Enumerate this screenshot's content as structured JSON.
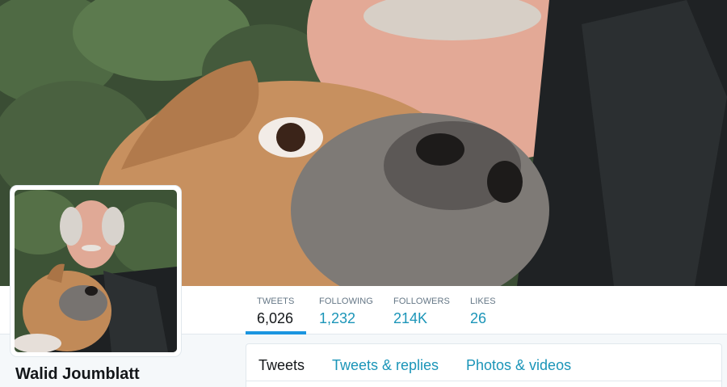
{
  "profile": {
    "name": "Walid Joumblatt"
  },
  "stats": [
    {
      "label": "TWEETS",
      "value": "6,026"
    },
    {
      "label": "FOLLOWING",
      "value": "1,232"
    },
    {
      "label": "FOLLOWERS",
      "value": "214K"
    },
    {
      "label": "LIKES",
      "value": "26"
    }
  ],
  "tabs": [
    {
      "label": "Tweets"
    },
    {
      "label": "Tweets & replies"
    },
    {
      "label": "Photos & videos"
    }
  ],
  "colors": {
    "link": "#1b95b8",
    "active_underline": "#1b95e0",
    "text": "#14171a",
    "muted": "#657786",
    "background": "#f5f8fa"
  }
}
